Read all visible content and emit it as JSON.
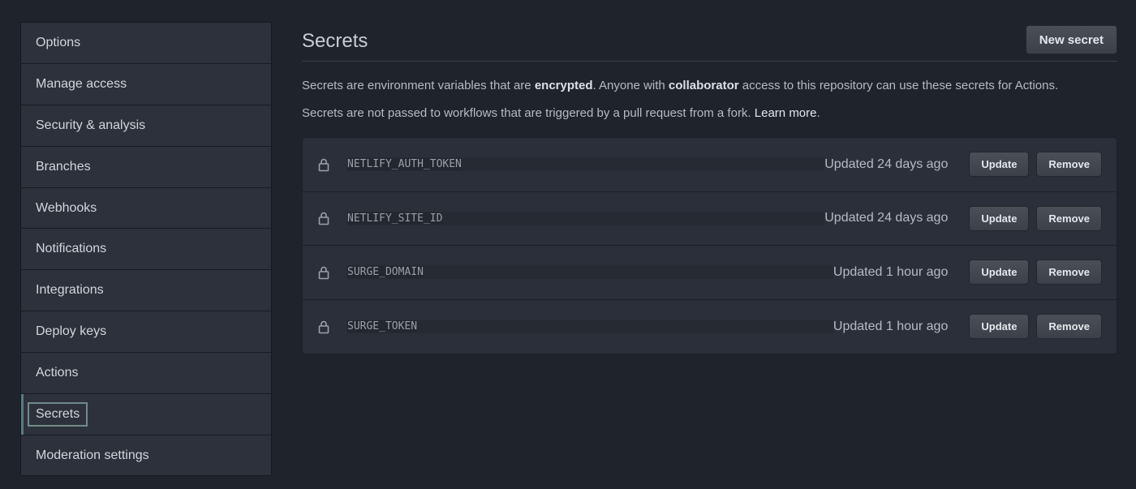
{
  "sidebar": {
    "items": [
      {
        "label": "Options"
      },
      {
        "label": "Manage access"
      },
      {
        "label": "Security & analysis"
      },
      {
        "label": "Branches"
      },
      {
        "label": "Webhooks"
      },
      {
        "label": "Notifications"
      },
      {
        "label": "Integrations"
      },
      {
        "label": "Deploy keys"
      },
      {
        "label": "Actions"
      },
      {
        "label": "Secrets",
        "active": true
      },
      {
        "label": "Moderation settings"
      }
    ]
  },
  "header": {
    "title": "Secrets",
    "new_button": "New secret"
  },
  "description": {
    "line1_a": "Secrets are environment variables that are ",
    "line1_b": "encrypted",
    "line1_c": ". Anyone with ",
    "line1_d": "collaborator",
    "line1_e": " access to this repository can use these secrets for Actions.",
    "line2_a": "Secrets are not passed to workflows that are triggered by a pull request from a fork. ",
    "line2_link": "Learn more",
    "line2_end": "."
  },
  "secrets": [
    {
      "name": "NETLIFY_AUTH_TOKEN",
      "updated": "Updated 24 days ago",
      "update_label": "Update",
      "remove_label": "Remove"
    },
    {
      "name": "NETLIFY_SITE_ID",
      "updated": "Updated 24 days ago",
      "update_label": "Update",
      "remove_label": "Remove"
    },
    {
      "name": "SURGE_DOMAIN",
      "updated": "Updated 1 hour ago",
      "update_label": "Update",
      "remove_label": "Remove"
    },
    {
      "name": "SURGE_TOKEN",
      "updated": "Updated 1 hour ago",
      "update_label": "Update",
      "remove_label": "Remove"
    }
  ],
  "icons": {
    "secret_icon": "lock-icon"
  },
  "colors": {
    "background": "#1f232c",
    "panel": "#2d313b",
    "active_outline": "#6e8b88"
  }
}
